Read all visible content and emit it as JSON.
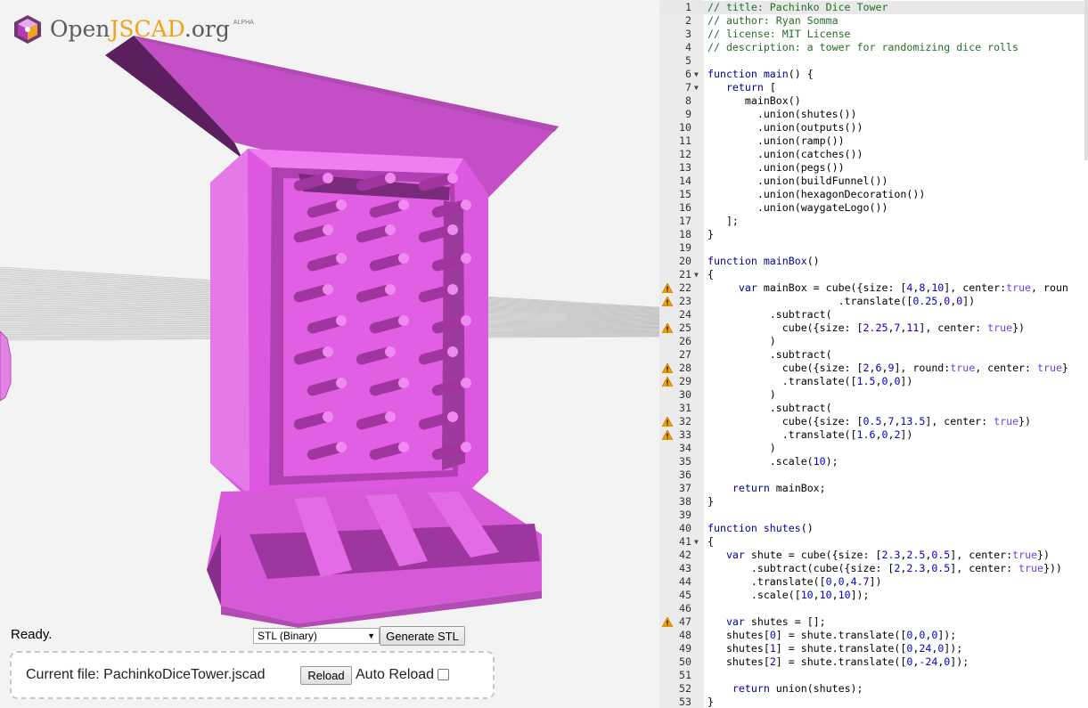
{
  "logo": {
    "prefix": "Open",
    "accent": "JSCAD",
    "suffix": ".org",
    "badge": "ALPHA"
  },
  "status": "Ready.",
  "export": {
    "format": "STL (Binary)",
    "generate_label": "Generate STL"
  },
  "file": {
    "current_label": "Current file: PachinkoDiceTower.jscad",
    "reload_label": "Reload",
    "auto_reload_label": "Auto Reload",
    "auto_reload_checked": false
  },
  "colors": {
    "model": "#e25ce4",
    "model_dark": "#7a2a7a",
    "comment": "#236e24",
    "keyword": "#0000a2",
    "number": "#0000cd",
    "warning": "#f0a000"
  },
  "editor": {
    "active_line": 1,
    "lines": [
      {
        "n": "1",
        "h": "<span class='tok-c'>// title: Pachinko Dice Tower</span>"
      },
      {
        "n": "2",
        "h": "<span class='tok-c'>// author: Ryan Somma</span>"
      },
      {
        "n": "3",
        "h": "<span class='tok-c'>// license: MIT License</span>"
      },
      {
        "n": "4",
        "h": "<span class='tok-c'>// description: a tower for randomizing dice rolls</span>"
      },
      {
        "n": "5",
        "h": ""
      },
      {
        "n": "6",
        "fold": true,
        "h": "<span class='tok-k'>function</span> <span class='tok-f'>main</span>() {"
      },
      {
        "n": "7",
        "fold": true,
        "h": "   <span class='tok-k'>return</span> ["
      },
      {
        "n": "8",
        "h": "      mainBox()"
      },
      {
        "n": "9",
        "h": "        .union(shutes())"
      },
      {
        "n": "10",
        "h": "        .union(outputs())"
      },
      {
        "n": "11",
        "h": "        .union(ramp())"
      },
      {
        "n": "12",
        "h": "        .union(catches())"
      },
      {
        "n": "13",
        "h": "        .union(pegs())"
      },
      {
        "n": "14",
        "h": "        .union(buildFunnel())"
      },
      {
        "n": "15",
        "h": "        .union(hexagonDecoration())"
      },
      {
        "n": "16",
        "h": "        .union(waygateLogo())"
      },
      {
        "n": "17",
        "h": "   ];"
      },
      {
        "n": "18",
        "h": "}"
      },
      {
        "n": "19",
        "h": ""
      },
      {
        "n": "20",
        "h": "<span class='tok-k'>function</span> <span class='tok-f'>mainBox</span>()"
      },
      {
        "n": "21",
        "fold": true,
        "h": "{"
      },
      {
        "n": "22",
        "warn": true,
        "h": "     <span class='tok-k'>var</span> mainBox = cube({size: [<span class='tok-n'>4</span>,<span class='tok-n'>8</span>,<span class='tok-n'>10</span>], center:<span class='tok-b'>true</span>, roun"
      },
      {
        "n": "23",
        "warn": true,
        "h": "                     .translate([<span class='tok-n'>0.25</span>,<span class='tok-n'>0</span>,<span class='tok-n'>0</span>])"
      },
      {
        "n": "24",
        "h": "          .subtract("
      },
      {
        "n": "25",
        "warn": true,
        "h": "            cube({size: [<span class='tok-n'>2.25</span>,<span class='tok-n'>7</span>,<span class='tok-n'>11</span>], center: <span class='tok-b'>true</span>})"
      },
      {
        "n": "26",
        "h": "          )"
      },
      {
        "n": "27",
        "h": "          .subtract("
      },
      {
        "n": "28",
        "warn": true,
        "h": "            cube({size: [<span class='tok-n'>2</span>,<span class='tok-n'>6</span>,<span class='tok-n'>9</span>], round:<span class='tok-b'>true</span>, center: <span class='tok-b'>true</span>}"
      },
      {
        "n": "29",
        "warn": true,
        "h": "            .translate([<span class='tok-n'>1.5</span>,<span class='tok-n'>0</span>,<span class='tok-n'>0</span>])"
      },
      {
        "n": "30",
        "h": "          )"
      },
      {
        "n": "31",
        "h": "          .subtract("
      },
      {
        "n": "32",
        "warn": true,
        "h": "            cube({size: [<span class='tok-n'>0.5</span>,<span class='tok-n'>7</span>,<span class='tok-n'>13.5</span>], center: <span class='tok-b'>true</span>})"
      },
      {
        "n": "33",
        "warn": true,
        "h": "            .translate([<span class='tok-n'>1.6</span>,<span class='tok-n'>0</span>,<span class='tok-n'>2</span>])"
      },
      {
        "n": "34",
        "h": "          )"
      },
      {
        "n": "35",
        "h": "          .scale(<span class='tok-n'>10</span>);"
      },
      {
        "n": "36",
        "h": ""
      },
      {
        "n": "37",
        "h": "    <span class='tok-k'>return</span> mainBox;"
      },
      {
        "n": "38",
        "h": "}"
      },
      {
        "n": "39",
        "h": ""
      },
      {
        "n": "40",
        "h": "<span class='tok-k'>function</span> <span class='tok-f'>shutes</span>()"
      },
      {
        "n": "41",
        "fold": true,
        "h": "{"
      },
      {
        "n": "42",
        "h": "   <span class='tok-k'>var</span> shute = cube({size: [<span class='tok-n'>2.3</span>,<span class='tok-n'>2.5</span>,<span class='tok-n'>0.5</span>], center:<span class='tok-b'>true</span>})"
      },
      {
        "n": "43",
        "h": "       .subtract(cube({size: [<span class='tok-n'>2</span>,<span class='tok-n'>2.3</span>,<span class='tok-n'>0.5</span>], center: <span class='tok-b'>true</span>}))"
      },
      {
        "n": "44",
        "h": "       .translate([<span class='tok-n'>0</span>,<span class='tok-n'>0</span>,<span class='tok-n'>4.7</span>])"
      },
      {
        "n": "45",
        "h": "       .scale([<span class='tok-n'>10</span>,<span class='tok-n'>10</span>,<span class='tok-n'>10</span>]);"
      },
      {
        "n": "46",
        "h": ""
      },
      {
        "n": "47",
        "warn": true,
        "h": "   <span class='tok-k'>var</span> shutes = [];"
      },
      {
        "n": "48",
        "h": "   shutes[<span class='tok-n'>0</span>] = shute.translate([<span class='tok-n'>0</span>,<span class='tok-n'>0</span>,<span class='tok-n'>0</span>]);"
      },
      {
        "n": "49",
        "h": "   shutes[<span class='tok-n'>1</span>] = shute.translate([<span class='tok-n'>0</span>,<span class='tok-n'>24</span>,<span class='tok-n'>0</span>]);"
      },
      {
        "n": "50",
        "h": "   shutes[<span class='tok-n'>2</span>] = shute.translate([<span class='tok-n'>0</span>,<span class='tok-n'>-24</span>,<span class='tok-n'>0</span>]);"
      },
      {
        "n": "51",
        "h": ""
      },
      {
        "n": "52",
        "h": "    <span class='tok-k'>return</span> union(shutes);"
      },
      {
        "n": "53",
        "h": "}"
      }
    ]
  }
}
